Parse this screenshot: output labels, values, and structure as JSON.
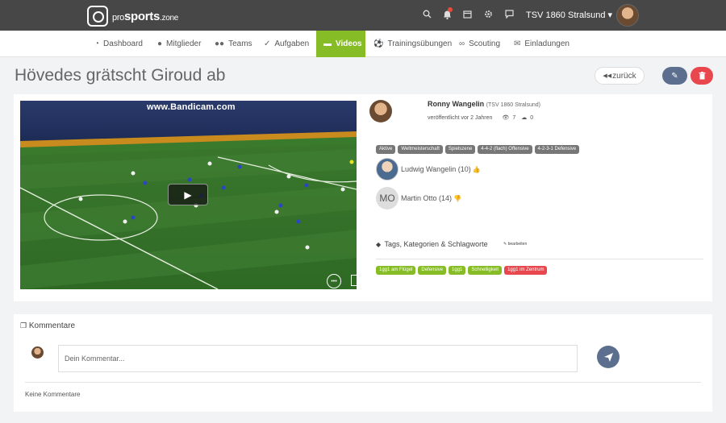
{
  "brand": {
    "prefix": "pro",
    "main": "sports",
    "suffix": ".zone"
  },
  "topbar": {
    "icons": [
      "search-icon",
      "bell-icon",
      "calendar-icon",
      "gear-icon",
      "chat-icon"
    ],
    "club": "TSV 1860 Stralsund",
    "caret": "▾"
  },
  "nav": {
    "items": [
      {
        "label": "Dashboard",
        "icon": "dashboard-icon",
        "glyph": "◔"
      },
      {
        "label": "Mitglieder",
        "icon": "user-icon",
        "glyph": "●"
      },
      {
        "label": "Teams",
        "icon": "users-icon",
        "glyph": "●●"
      },
      {
        "label": "Aufgaben",
        "icon": "check-circle-icon",
        "glyph": "✓"
      },
      {
        "label": "Videos",
        "icon": "video-icon",
        "glyph": "▬"
      },
      {
        "label": "Trainingsübungen",
        "icon": "soccer-ball-icon",
        "glyph": "⚽"
      },
      {
        "label": "Scouting",
        "icon": "binoculars-icon",
        "glyph": "∞"
      },
      {
        "label": "Einladungen",
        "icon": "envelope-icon",
        "glyph": "✉"
      }
    ],
    "active": "Videos"
  },
  "page": {
    "title": "Hövedes grätscht Giroud ab",
    "back_label": "zurück",
    "back_glyph": "◀◀",
    "edit_glyph": "✎",
    "delete_glyph": "🗑"
  },
  "video": {
    "watermark": "www.Bandicam.com",
    "play_glyph": "▶",
    "ctrl_glyph": "•••"
  },
  "author": {
    "name": "Ronny Wangelin",
    "club": "(TSV 1860 Stralsund)",
    "published": "veröffentlicht vor 2 Jahren",
    "views": "7",
    "downloads": "0",
    "view_glyph": "👁",
    "download_glyph": "☁"
  },
  "categories": [
    "Aktive",
    "Weltmeisterschaft",
    "Spielszene",
    "4-4-2 (flach) Offensive",
    "4-2-3-1 Defensive"
  ],
  "players": [
    {
      "name": "Ludwig Wangelin (10)",
      "rating": "up",
      "glyph": "👍"
    },
    {
      "name": "Martin Otto (14)",
      "initials": "MO",
      "rating": "down",
      "glyph": "👎"
    }
  ],
  "tags_section": {
    "title": "Tags, Kategorien & Schlagworte",
    "edit_label": "bearbeiten",
    "icon_glyph": "✎",
    "title_glyph": "◆"
  },
  "tags": [
    {
      "label": "1gg1 am Flügel",
      "color": "green"
    },
    {
      "label": "Defensive",
      "color": "green"
    },
    {
      "label": "1gg1",
      "color": "green"
    },
    {
      "label": "Schnelligkeit",
      "color": "green"
    },
    {
      "label": "1gg1 im Zentrum",
      "color": "red"
    }
  ],
  "comments": {
    "title": "Kommentare",
    "title_glyph": "❐",
    "placeholder": "Dein Kommentar...",
    "send_glyph": "➤",
    "empty": "Keine Kommentare"
  },
  "colors": {
    "accent": "#86bc25",
    "danger": "#e8474d",
    "primary": "#5c6f8e",
    "topbar": "#474747"
  }
}
